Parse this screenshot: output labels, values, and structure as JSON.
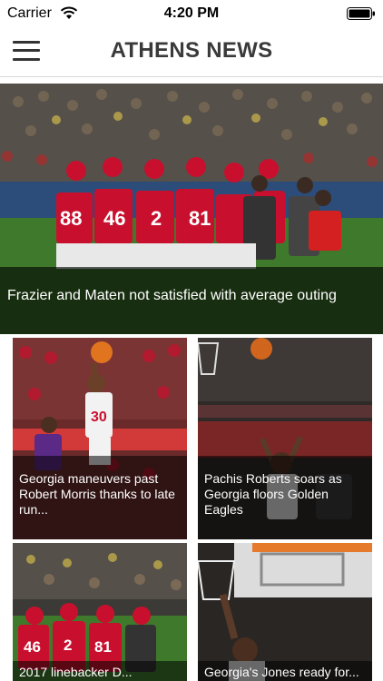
{
  "status_bar": {
    "carrier": "Carrier",
    "time": "4:20 PM",
    "wifi_icon": "wifi-icon",
    "battery_icon": "battery-icon"
  },
  "header": {
    "title": "ATHENS NEWS",
    "menu_icon": "hamburger-menu-icon"
  },
  "hero": {
    "caption": "Frazier and Maten not satisfied with average outing"
  },
  "cards": [
    {
      "caption": "Georgia maneuvers past Robert Morris thanks to late run..."
    },
    {
      "caption": "Pachis Roberts soars as Georgia floors Golden Eagles"
    },
    {
      "caption": "2017 linebacker D..."
    },
    {
      "caption": "Georgia's Jones ready for..."
    }
  ],
  "colors": {
    "jersey_red": "#c8102e",
    "header_text": "#3a3a3a",
    "caption_overlay": "rgba(0,0,0,0.6)"
  }
}
